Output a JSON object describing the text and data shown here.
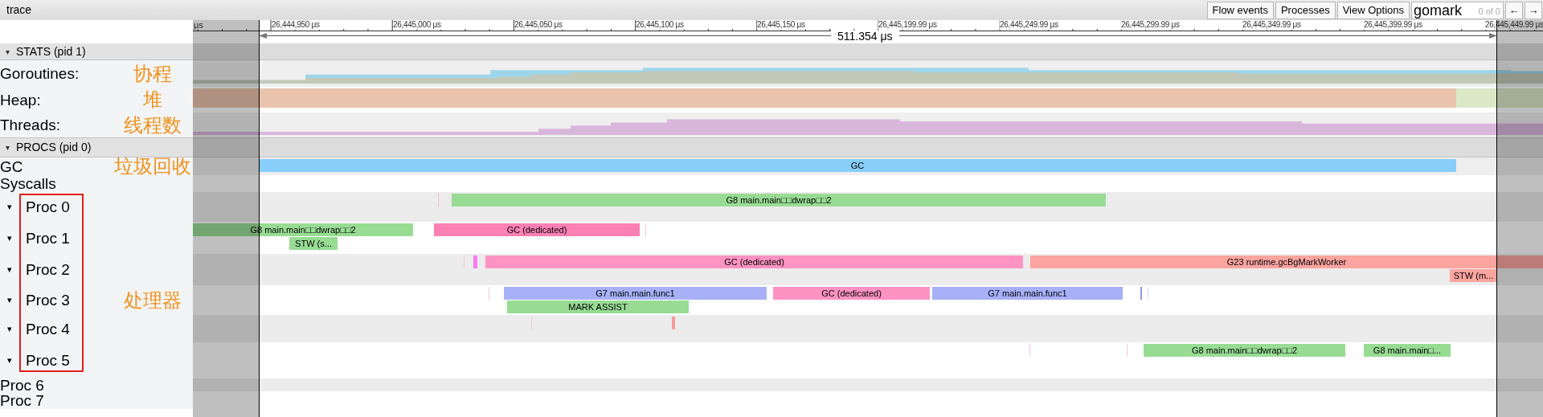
{
  "window": {
    "title": "trace"
  },
  "toolbar": {
    "buttons": [
      "Flow events",
      "Processes",
      "View Options"
    ],
    "search": {
      "value": "gomark",
      "match_count": "0 of 0"
    },
    "nav_buttons": [
      "←",
      "→"
    ]
  },
  "ruler": {
    "cut_label": "μs",
    "ticks": [
      "26,444,950 μs",
      "26,445,000 μs",
      "26,445,050 μs",
      "26,445,100 μs",
      "26,445,150 μs",
      "26,445,199.99 μs",
      "26,445,249.99 μs",
      "26,445,299.99 μs",
      "26,445,349.99 μs",
      "26,445,399.99 μs",
      "26,445,449.99 μs"
    ],
    "duration": "511.354 μs"
  },
  "sections": [
    {
      "toggle": "▾",
      "label": "STATS (pid 1)",
      "tracks": [
        {
          "kind": "counter",
          "label": "Goroutines:",
          "annotation": "协程"
        },
        {
          "kind": "counter",
          "label": "Heap:",
          "annotation": "堆"
        },
        {
          "kind": "counter",
          "label": "Threads:",
          "annotation": "线程数"
        }
      ]
    },
    {
      "toggle": "▾",
      "label": "PROCS (pid 0)",
      "tracks": [
        {
          "kind": "thread",
          "label": "GC",
          "annotation": "垃圾回收",
          "slices": [
            {
              "kind": "slice",
              "label": "GC",
              "color": "#87cefa"
            }
          ]
        },
        {
          "kind": "thread",
          "label": "Syscalls"
        },
        {
          "kind": "proc",
          "toggle": "▾",
          "label": "Proc 0",
          "slices": [
            {
              "kind": "mark",
              "color": "#f7b3d0"
            },
            {
              "kind": "slice",
              "label": "G8 main.main□□dwrap□□2",
              "color": "#98dc94"
            }
          ]
        },
        {
          "kind": "proc",
          "toggle": "▾",
          "label": "Proc 1",
          "slices": [
            {
              "kind": "slice",
              "label": "G8 main.main□□dwrap□□2",
              "color": "#98dc94"
            },
            {
              "kind": "slice",
              "label": "STW (s...",
              "color": "#98dc94"
            },
            {
              "kind": "slice",
              "label": "GC (dedicated)",
              "color": "#fb80b4"
            },
            {
              "kind": "mark",
              "color": "#f7c3da"
            }
          ]
        },
        {
          "kind": "proc",
          "toggle": "▾",
          "label": "Proc 2",
          "slices": [
            {
              "kind": "mark",
              "color": "#f7c3da"
            },
            {
              "kind": "mark",
              "color": "#f77cf3"
            },
            {
              "kind": "slice",
              "label": "GC (dedicated)",
              "color": "#fd93c2"
            },
            {
              "kind": "slice",
              "label": "G23 runtime.gcBgMarkWorker",
              "color": "#fba4a0"
            },
            {
              "kind": "slice",
              "label": "STW (m...",
              "color": "#fba4a0"
            }
          ]
        },
        {
          "kind": "proc",
          "toggle": "▾",
          "label": "Proc 3",
          "annotation": "处理器",
          "slices": [
            {
              "kind": "mark",
              "color": "#f7c3da"
            },
            {
              "kind": "slice",
              "label": "G7 main.main.func1",
              "color": "#a8b0f8"
            },
            {
              "kind": "slice",
              "label": "MARK ASSIST",
              "color": "#98dc94"
            },
            {
              "kind": "slice",
              "label": "GC (dedicated)",
              "color": "#fd93c2"
            },
            {
              "kind": "slice",
              "label": "G7 main.main.func1",
              "color": "#a8b0f8"
            },
            {
              "kind": "mark",
              "color": "#8f98f0"
            },
            {
              "kind": "mark",
              "color": "#d8d8f4"
            }
          ]
        },
        {
          "kind": "proc",
          "toggle": "▾",
          "label": "Proc 4",
          "slices": [
            {
              "kind": "mark",
              "color": "#f7c3da"
            },
            {
              "kind": "mark",
              "color": "#f99a9a"
            }
          ]
        },
        {
          "kind": "proc",
          "toggle": "▾",
          "label": "Proc 5",
          "slices": [
            {
              "kind": "mark",
              "color": "#f7c3da"
            },
            {
              "kind": "mark",
              "color": "#f7c3da"
            },
            {
              "kind": "slice",
              "label": "G8 main.main□□dwrap□□2",
              "color": "#98dc94"
            },
            {
              "kind": "slice",
              "label": "G8 main.main□...",
              "color": "#98dc94"
            }
          ]
        },
        {
          "kind": "thread",
          "label": "Proc 6"
        },
        {
          "kind": "thread",
          "label": "Proc 7"
        }
      ]
    }
  ]
}
